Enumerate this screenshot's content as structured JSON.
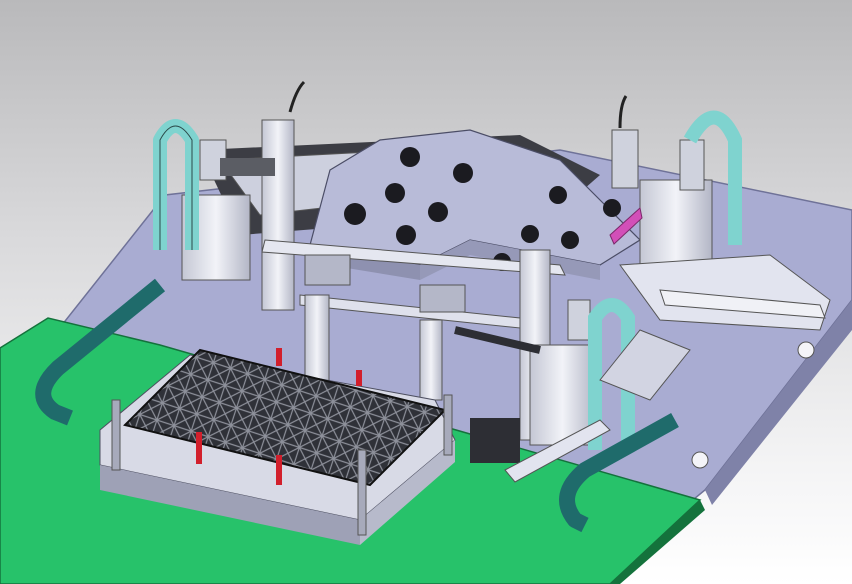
{
  "colors": {
    "background_top": "#b9b9bb",
    "background_bottom": "#ffffff",
    "base_plate": "#a9acd2",
    "base_plate_edge": "#6f7298",
    "green_plate": "#27c26a",
    "green_plate_edge": "#14723c",
    "teal_cable_chain": "#1f6b6b",
    "light_teal_cable_chain": "#7fd3cf",
    "tray_grid": "#2f3138",
    "red_locator_pin": "#d21f2c",
    "magenta_part": "#d24fb8",
    "metal_light": "#e9ebf3",
    "metal_mid": "#c9cbd8"
  },
  "icons": [
    "cad-3d-model"
  ]
}
